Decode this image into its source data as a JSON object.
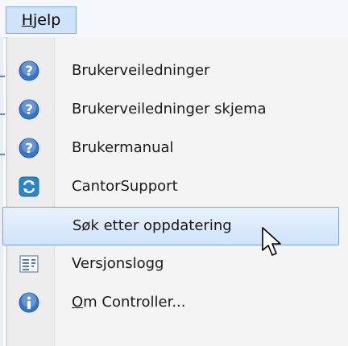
{
  "menubar": {
    "open_menu": {
      "accel": "H",
      "rest": "jelp"
    }
  },
  "menu": {
    "items": [
      {
        "label": "Brukerveiledninger",
        "icon": "help-icon"
      },
      {
        "label": "Brukerveiledninger skjema",
        "icon": "help-icon"
      },
      {
        "label": "Brukermanual",
        "icon": "help-icon"
      },
      {
        "label": "CantorSupport",
        "icon": "support-icon"
      },
      {
        "label": "Søk etter oppdatering",
        "icon": null,
        "selected": true
      },
      {
        "label": "Versjonslogg",
        "icon": "log-icon"
      },
      {
        "accel": "O",
        "rest": "m Controller...",
        "icon": "info-icon"
      }
    ]
  },
  "colors": {
    "selection_border": "#7da2ce",
    "selection_fill": "#cfe3fb",
    "help_icon": "#3b74c7"
  }
}
